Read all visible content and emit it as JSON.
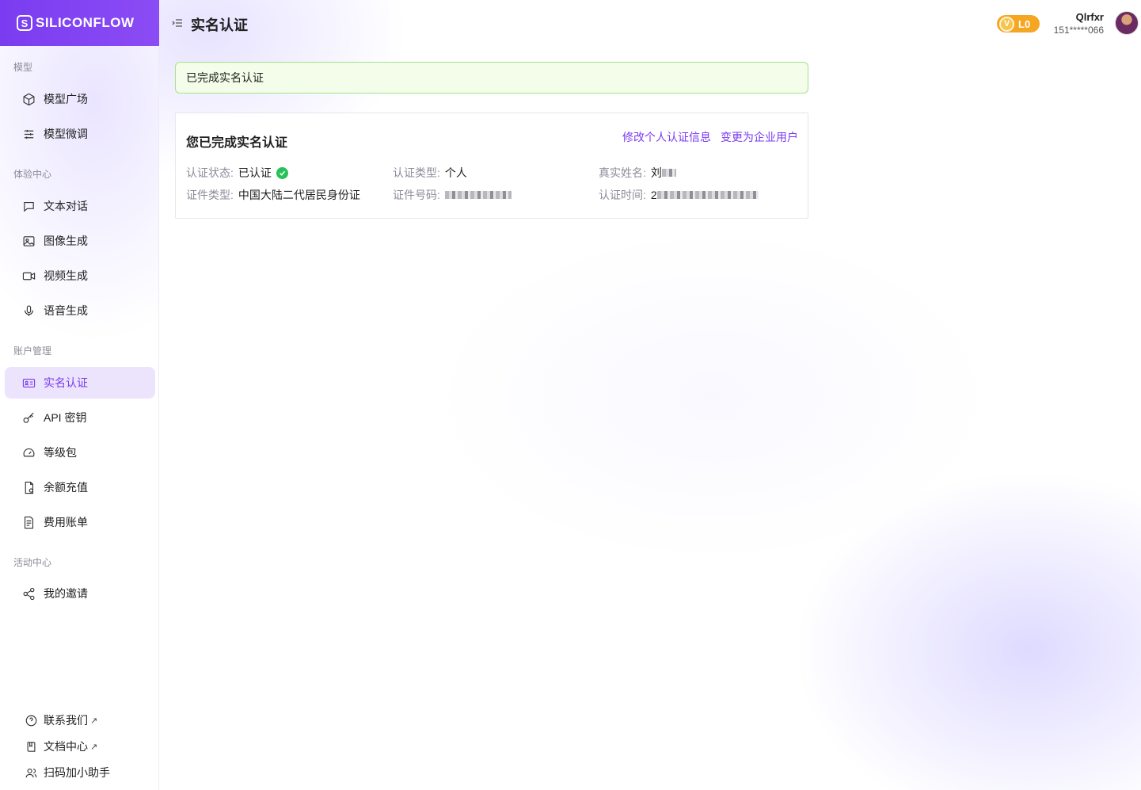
{
  "app": {
    "logo_text": "SILICONFLOW",
    "logo_mark": "S"
  },
  "sidebar": {
    "sections": [
      {
        "title": "模型",
        "items": [
          {
            "label": "模型广场",
            "icon": "cube-icon"
          },
          {
            "label": "模型微调",
            "icon": "sliders-icon"
          }
        ]
      },
      {
        "title": "体验中心",
        "items": [
          {
            "label": "文本对话",
            "icon": "chat-icon"
          },
          {
            "label": "图像生成",
            "icon": "image-icon"
          },
          {
            "label": "视频生成",
            "icon": "video-icon"
          },
          {
            "label": "语音生成",
            "icon": "mic-icon"
          }
        ]
      },
      {
        "title": "账户管理",
        "items": [
          {
            "label": "实名认证",
            "icon": "id-card-icon",
            "active": true
          },
          {
            "label": "API 密钥",
            "icon": "key-icon"
          },
          {
            "label": "等级包",
            "icon": "gauge-icon"
          },
          {
            "label": "余额充值",
            "icon": "wallet-icon"
          },
          {
            "label": "费用账单",
            "icon": "bill-icon"
          }
        ]
      },
      {
        "title": "活动中心",
        "items": [
          {
            "label": "我的邀请",
            "icon": "share-icon"
          }
        ]
      }
    ],
    "footer": [
      {
        "label": "联系我们",
        "icon": "help-icon",
        "external": "↗"
      },
      {
        "label": "文档中心",
        "icon": "book-icon",
        "external": "↗"
      },
      {
        "label": "扫码加小助手",
        "icon": "user-icon"
      }
    ]
  },
  "header": {
    "title": "实名认证",
    "level": {
      "badge_letter": "V",
      "label": "L0"
    },
    "user": {
      "name": "Qlrfxr",
      "phone": "151*****066"
    }
  },
  "main": {
    "alert": "已完成实名认证",
    "card": {
      "title": "您已完成实名认证",
      "links": [
        "修改个人认证信息",
        "变更为企业用户"
      ],
      "fields": {
        "status_label": "认证状态:",
        "status_value": "已认证",
        "type_label": "认证类型:",
        "type_value": "个人",
        "name_label": "真实姓名:",
        "name_value": "刘",
        "doc_type_label": "证件类型:",
        "doc_type_value": "中国大陆二代居民身份证",
        "doc_no_label": "证件号码:",
        "time_label": "认证时间:",
        "time_value": "2"
      }
    }
  },
  "colors": {
    "brand": "#7a3cf0",
    "success": "#27c15a",
    "level": "#f5a623"
  }
}
